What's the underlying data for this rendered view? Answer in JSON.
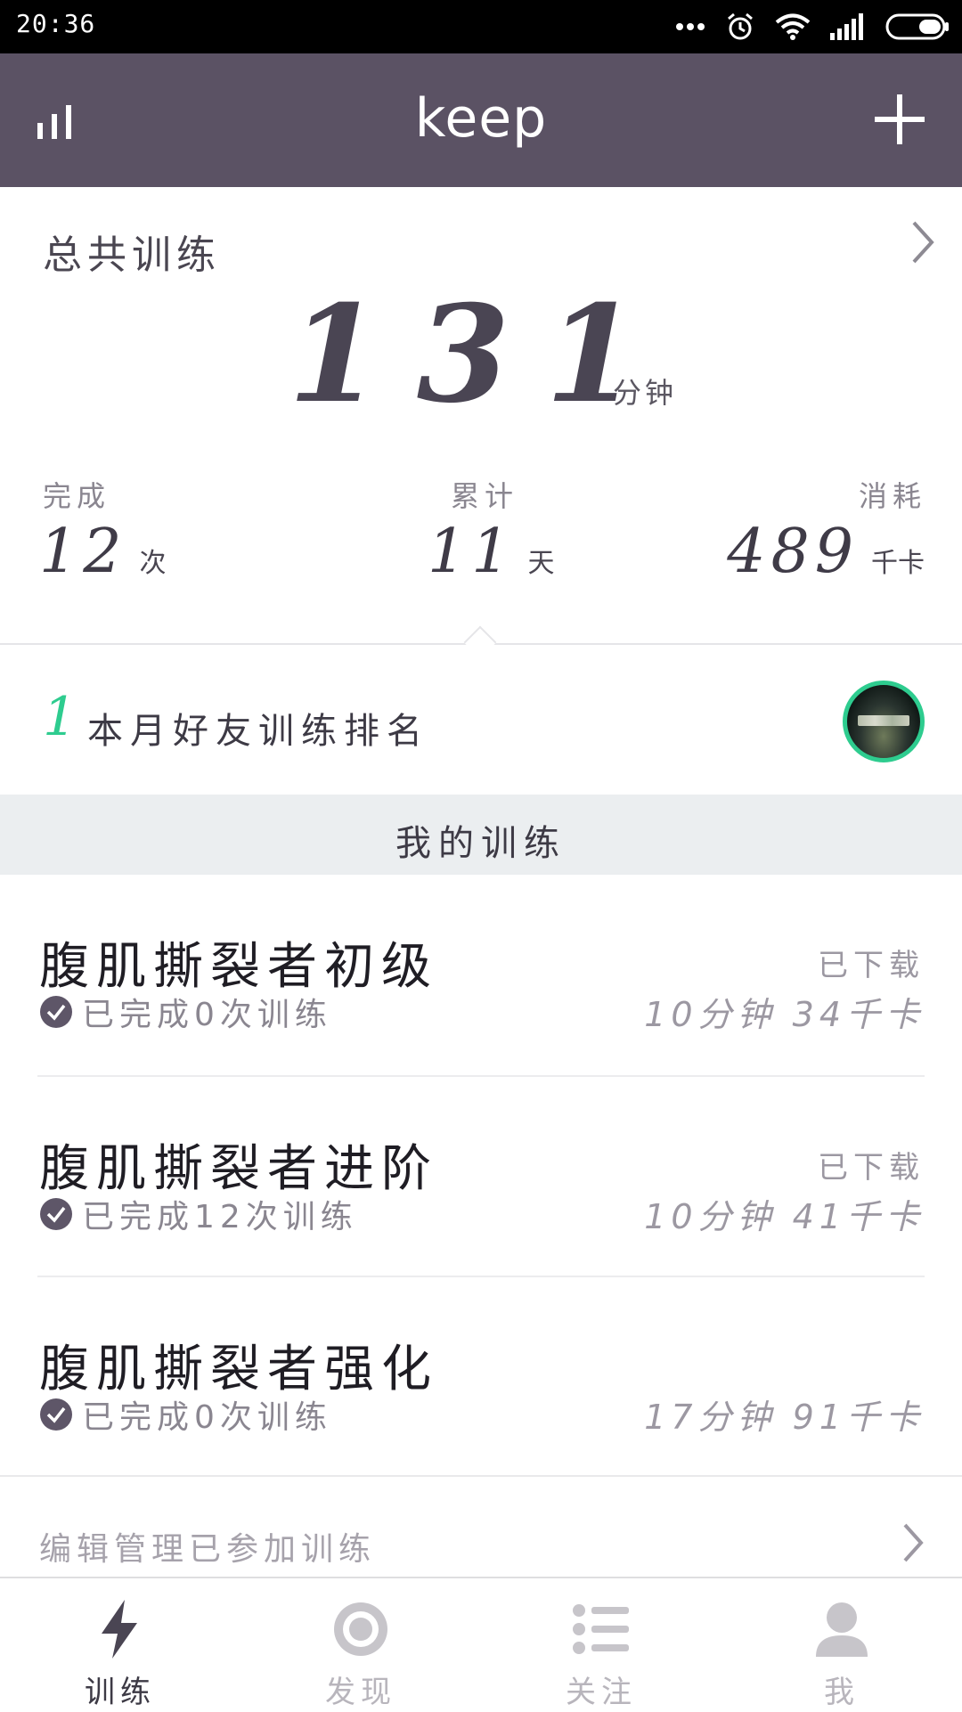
{
  "status_bar": {
    "time": "20:36",
    "icons": [
      "more-dots-icon",
      "alarm-icon",
      "wifi-icon",
      "signal-icon",
      "battery-icon"
    ]
  },
  "header": {
    "title": "keep",
    "left_icon": "stats-icon",
    "right_icon": "add-icon",
    "background": "#5b5264"
  },
  "summary": {
    "title": "总共训练",
    "total_value": "131",
    "total_unit": "分钟",
    "stats": [
      {
        "label": "完成",
        "value": "12",
        "unit": "次"
      },
      {
        "label": "累计",
        "value": "11",
        "unit": "天"
      },
      {
        "label": "消耗",
        "value": "489",
        "unit": "千卡"
      }
    ]
  },
  "ranking": {
    "number": "1",
    "label": "本月好友训练排名",
    "accent": "#2ecc8f"
  },
  "section": {
    "title": "我的训练"
  },
  "workouts": [
    {
      "name": "腹肌撕裂者初级",
      "done": "已完成0次训练",
      "download": "已下载",
      "meta": "10分钟 34千卡"
    },
    {
      "name": "腹肌撕裂者进阶",
      "done": "已完成12次训练",
      "download": "已下载",
      "meta": "10分钟 41千卡"
    },
    {
      "name": "腹肌撕裂者强化",
      "done": "已完成0次训练",
      "download": "",
      "meta": "17分钟 91千卡"
    }
  ],
  "edit": {
    "label": "编辑管理已参加训练"
  },
  "tabs": [
    {
      "label": "训练",
      "icon": "lightning-icon",
      "active": true
    },
    {
      "label": "发现",
      "icon": "target-icon",
      "active": false
    },
    {
      "label": "关注",
      "icon": "list-icon",
      "active": false
    },
    {
      "label": "我",
      "icon": "person-icon",
      "active": false
    }
  ]
}
